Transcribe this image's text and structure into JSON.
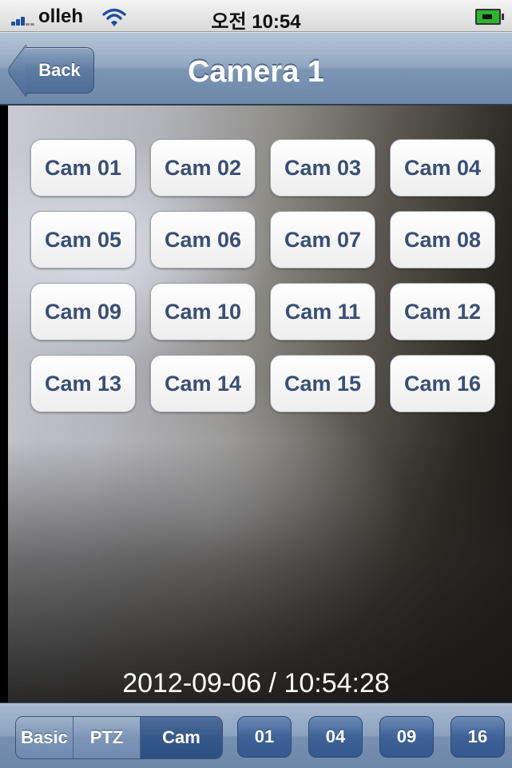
{
  "status_bar": {
    "carrier": "olleh",
    "time": "오전 10:54"
  },
  "nav": {
    "back_label": "Back",
    "title": "Camera 1"
  },
  "cameras": [
    "Cam 01",
    "Cam 02",
    "Cam 03",
    "Cam 04",
    "Cam 05",
    "Cam 06",
    "Cam 07",
    "Cam 08",
    "Cam 09",
    "Cam 10",
    "Cam 11",
    "Cam 12",
    "Cam 13",
    "Cam 14",
    "Cam 15",
    "Cam 16"
  ],
  "video": {
    "timestamp": "2012-09-06 / 10:54:28"
  },
  "toolbar": {
    "segments": [
      {
        "label": "Basic",
        "selected": false
      },
      {
        "label": "PTZ",
        "selected": false
      },
      {
        "label": "Cam",
        "selected": true
      }
    ],
    "layout_buttons": [
      "01",
      "04",
      "09",
      "16"
    ]
  },
  "colors": {
    "nav_blue": "#7d95b3",
    "cam_text": "#3a4f75",
    "segment_selected": "#35588b",
    "battery_green": "#2db52d"
  }
}
